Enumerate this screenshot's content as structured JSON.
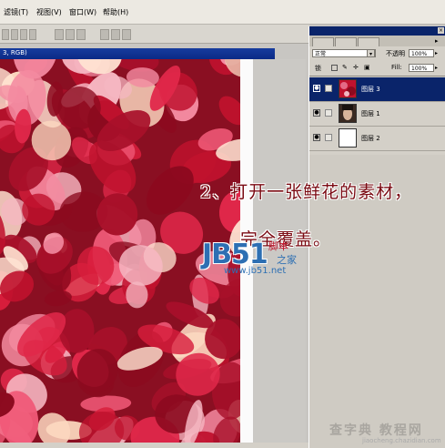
{
  "menubar": {
    "items": [
      "滤镜(T)",
      "视图(V)",
      "窗口(W)",
      "帮助(H)"
    ]
  },
  "document": {
    "title": "3, RGB)"
  },
  "layers_panel": {
    "blend_mode": "正常",
    "opacity_label": "不透明",
    "opacity_value": "100%",
    "lock_label": "锁",
    "fill_label": "Fill:",
    "fill_value": "100%",
    "layers": [
      {
        "name": "图层 3",
        "selected": true
      },
      {
        "name": "图层 1",
        "selected": false
      },
      {
        "name": "图层 2",
        "selected": false
      }
    ]
  },
  "overlay": {
    "line1": "2、打开一张鲜花的素材，",
    "line2": "完全覆盖。"
  },
  "watermark": {
    "logo": "JB51",
    "sub1": "脚本",
    "sub2": "之家",
    "url": "www.jb51.net",
    "bottom": "查字典 教程网",
    "bottom_url": "jiaocheng.chazidian.com"
  },
  "colors": {
    "title_blue": "#0a246a",
    "rose": "#b8142c"
  }
}
